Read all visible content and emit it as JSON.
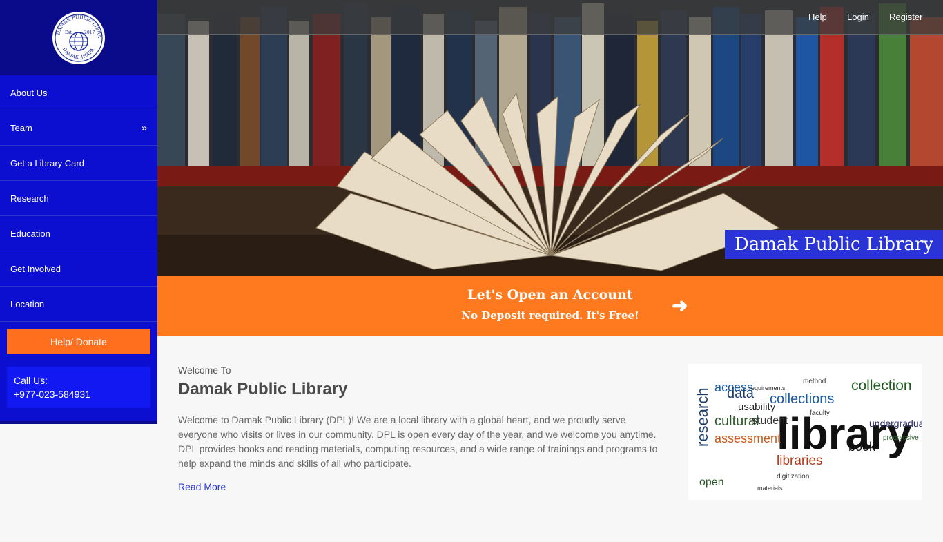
{
  "sidebar": {
    "logo_alt": "Damak Public Library seal",
    "logo": {
      "ring_top": "DAMAK PUBLIC LIBRARY",
      "ring_bottom": "DAMAK, JHAPA",
      "est": "Est.",
      "year": "2017"
    },
    "items": [
      {
        "label": "About Us",
        "has_chevron": false
      },
      {
        "label": "Team",
        "has_chevron": true
      },
      {
        "label": "Get a Library Card",
        "has_chevron": false
      },
      {
        "label": "Research",
        "has_chevron": false
      },
      {
        "label": "Education",
        "has_chevron": false
      },
      {
        "label": "Get Involved",
        "has_chevron": false
      },
      {
        "label": "Location",
        "has_chevron": false
      }
    ],
    "donate_label": "Help/ Donate",
    "call_label": "Call Us:",
    "call_number": "+977-023-584931"
  },
  "topbar": {
    "help": "Help",
    "login": "Login",
    "register": "Register"
  },
  "hero": {
    "title": "Damak Public Library"
  },
  "cta": {
    "title": "Let's Open an Account",
    "subtitle": "No Deposit required. It's Free!",
    "icon": "arrow-right-icon"
  },
  "main": {
    "welcome_to": "Welcome To",
    "title": "Damak Public Library",
    "text": "Welcome to Damak Public Library (DPL)! We are a local library with a global heart, and we proudly serve everyone who visits or lives in our community. DPL is open every day of the year, and we welcome you anytime. DPL provides books and reading materials, computing resources, and a wide range of trainings and programs to help expand the minds and skills of all who participate.",
    "read_more": "Read More"
  },
  "word_cloud": {
    "words": [
      "library",
      "research",
      "collections",
      "assessment",
      "cultural",
      "data",
      "access",
      "collection",
      "libraries",
      "student",
      "undergraduate",
      "usability",
      "book",
      "open",
      "digitization",
      "progressive",
      "materials",
      "requirements",
      "method",
      "faculty"
    ]
  },
  "colors": {
    "sidebar_blue": "#0d0fd0",
    "logo_bg": "#0a0b8a",
    "accent_orange": "#ff7a1f",
    "title_blue": "#2a33d6"
  }
}
